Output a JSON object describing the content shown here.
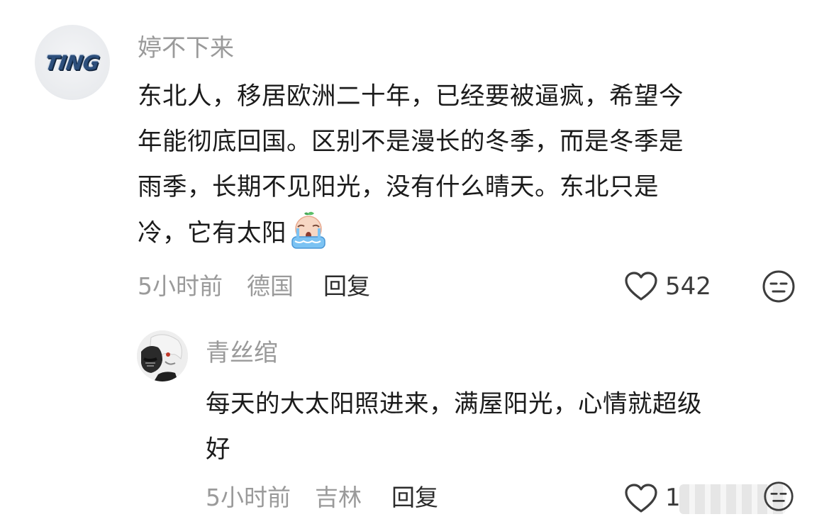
{
  "comment": {
    "avatar_text": "TING",
    "username": "婷不下来",
    "text_lines": [
      "东北人，移居欧洲二十年，已经要被逼疯，希望今",
      "年能彻底回国。区别不是漫长的冬季，而是冬季是",
      "雨季，长期不见阳光，没有什么晴天。东北只是",
      "冷，它有太阳"
    ],
    "emoji": "crying-emoji",
    "time": "5小时前",
    "location": "德国",
    "reply_label": "回复",
    "like_count": "542",
    "like_icon": "heart-outline-icon",
    "reaction_icon": "neutral-face-icon"
  },
  "reply": {
    "username": "青丝绾",
    "text_lines": [
      "每天的大太阳照进来，满屋阳光，心情就超级",
      "好"
    ],
    "time": "5小时前",
    "location": "吉林",
    "reply_label": "回复",
    "like_count": "1",
    "like_icon": "heart-outline-icon",
    "reaction_icon": "neutral-face-icon"
  }
}
